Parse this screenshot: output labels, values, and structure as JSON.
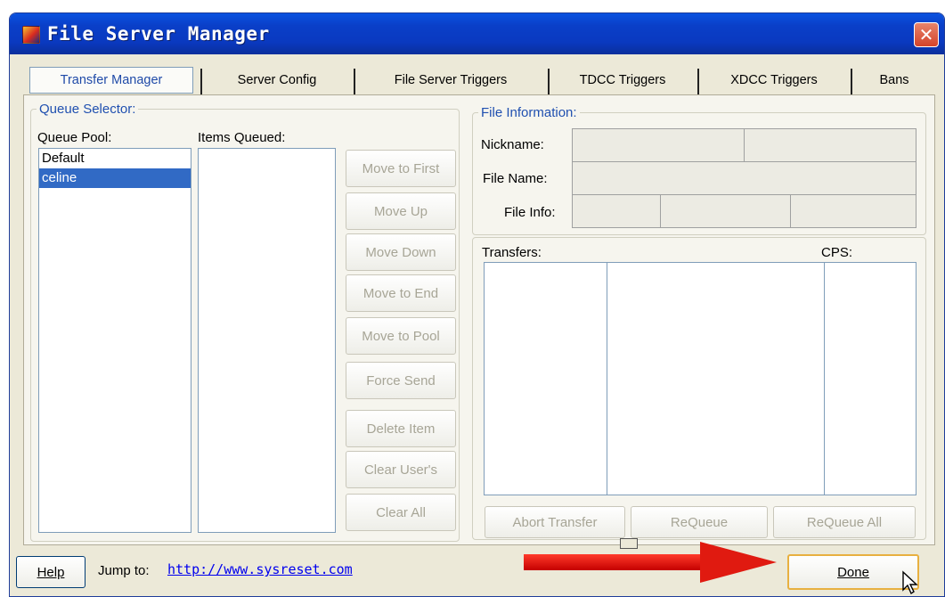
{
  "window": {
    "title": "File Server Manager",
    "close_label": "✕"
  },
  "tabs": [
    {
      "label": "Transfer Manager",
      "active": true
    },
    {
      "label": "Server Config"
    },
    {
      "label": "File Server Triggers"
    },
    {
      "label": "TDCC Triggers"
    },
    {
      "label": "XDCC Triggers"
    },
    {
      "label": "Bans"
    }
  ],
  "queue_selector": {
    "legend": "Queue Selector:",
    "pool_label": "Queue Pool:",
    "items_label": "Items Queued:",
    "pool_items": [
      "Default",
      "celine"
    ],
    "selected_pool": "celine"
  },
  "queue_buttons": {
    "move_to_first": "Move to First",
    "move_up": "Move Up",
    "move_down": "Move Down",
    "move_to_end": "Move to End",
    "move_to_pool": "Move to Pool",
    "force_send": "Force Send",
    "delete_item": "Delete Item",
    "clear_users": "Clear User's",
    "clear_all": "Clear All"
  },
  "file_info": {
    "legend": "File Information:",
    "nickname_label": "Nickname:",
    "filename_label": "File Name:",
    "fileinfo_label": "File Info:"
  },
  "transfers": {
    "label": "Transfers:",
    "cps_label": "CPS:",
    "abort": "Abort Transfer",
    "requeue": "ReQueue",
    "requeue_all": "ReQueue All"
  },
  "footer": {
    "help": "Help",
    "jump_to": "Jump to:",
    "url": "http://www.sysreset.com",
    "done": "Done"
  },
  "colors": {
    "titlebar": "#0a3fc8",
    "selection": "#316ac5",
    "arrow": "#e01a10"
  }
}
